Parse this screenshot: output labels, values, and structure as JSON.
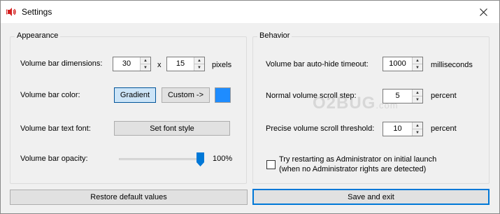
{
  "window": {
    "title": "Settings"
  },
  "appearance": {
    "title": "Appearance",
    "dimensions_label": "Volume bar dimensions:",
    "width_value": "30",
    "x_label": "x",
    "height_value": "15",
    "pixels_label": "pixels",
    "color_label": "Volume bar color:",
    "gradient_button": "Gradient",
    "custom_button": "Custom ->",
    "swatch_color": "#1e8cff",
    "font_label": "Volume bar text font:",
    "font_button": "Set font style",
    "opacity_label": "Volume bar opacity:",
    "opacity_value": "100%",
    "opacity_fraction": 1.0
  },
  "behavior": {
    "title": "Behavior",
    "autohide_label": "Volume bar auto-hide timeout:",
    "autohide_value": "1000",
    "autohide_unit": "milliseconds",
    "normal_step_label": "Normal volume scroll step:",
    "normal_step_value": "5",
    "normal_step_unit": "percent",
    "precise_label": "Precise volume scroll threshold:",
    "precise_value": "10",
    "precise_unit": "percent",
    "admin_checkbox_line1": "Try restarting as Administrator on initial launch",
    "admin_checkbox_line2": "(when no Administrator rights are detected)",
    "admin_checked": false
  },
  "footer": {
    "restore_button": "Restore default values",
    "save_button": "Save and exit"
  },
  "watermark": {
    "main": "O2BUG",
    "suffix": ".com"
  }
}
